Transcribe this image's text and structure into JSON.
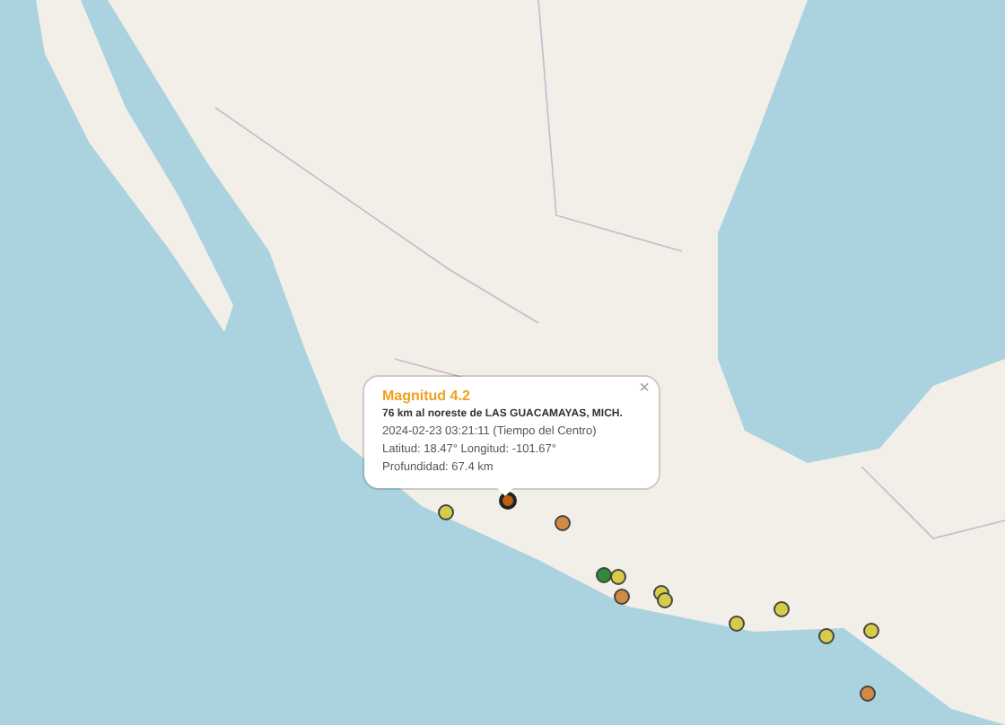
{
  "popup": {
    "title": "Magnitud 4.2",
    "location": "76 km al noreste de LAS GUACAMAYAS, MICH.",
    "datetime": "2024-02-23  03:21:11 (Tiempo del Centro)",
    "coordinates": "Latitud: 18.47°  Longitud: -101.67°",
    "depth": "Profundidad: 67.4 km",
    "close": "×"
  },
  "markers": [
    {
      "color": "#c0600f",
      "selected": true
    },
    {
      "color": "#d6cc48",
      "selected": false
    },
    {
      "color": "#d08a44",
      "selected": false
    },
    {
      "color": "#2f8a3a",
      "selected": false
    },
    {
      "color": "#d6cc48",
      "selected": false
    },
    {
      "color": "#d08a44",
      "selected": false
    },
    {
      "color": "#d6cc48",
      "selected": false
    },
    {
      "color": "#d6cc48",
      "selected": false
    },
    {
      "color": "#d6cc48",
      "selected": false
    },
    {
      "color": "#d6cc48",
      "selected": false
    },
    {
      "color": "#d6cc48",
      "selected": false
    },
    {
      "color": "#d6cc48",
      "selected": false
    },
    {
      "color": "#d08a44",
      "selected": false
    }
  ]
}
